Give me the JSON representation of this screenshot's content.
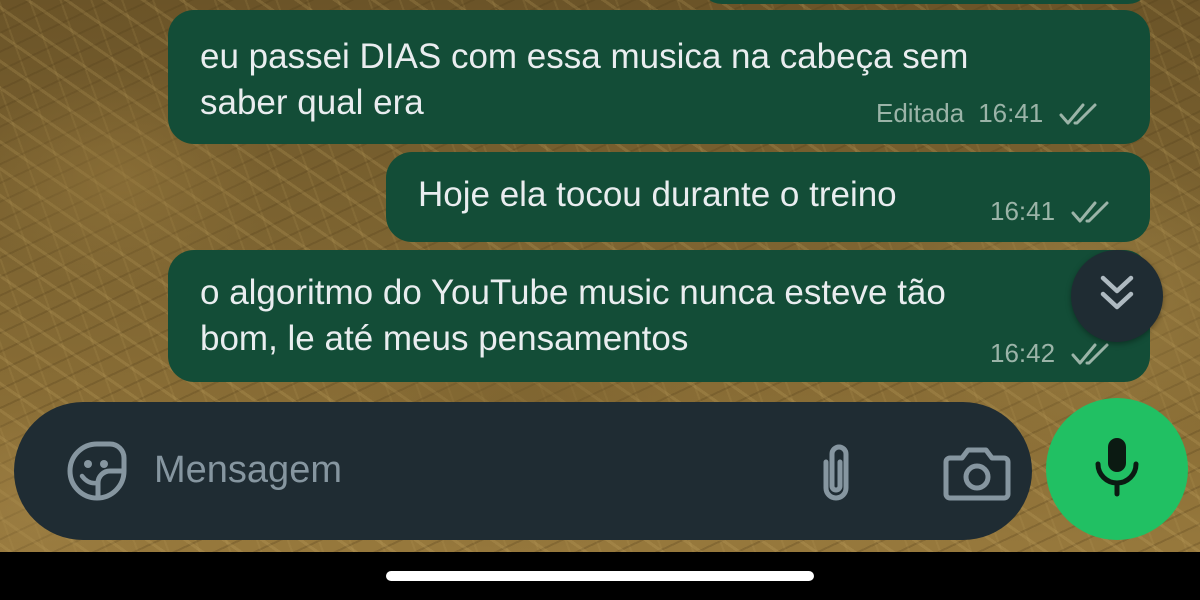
{
  "messages": [
    {
      "lines": [
        "eu passei DIAS com essa musica na cabeça sem",
        "saber qual era"
      ],
      "edited_label": "Editada",
      "time": "16:41",
      "status": "read"
    },
    {
      "lines": [
        "Hoje ela tocou durante o treino"
      ],
      "time": "16:41",
      "status": "read"
    },
    {
      "lines": [
        "o algoritmo do YouTube music nunca esteve tão",
        "bom, le até meus pensamentos"
      ],
      "time": "16:42",
      "status": "read"
    }
  ],
  "composer": {
    "placeholder": "Mensagem"
  },
  "icons": {
    "sticker": "sticker-icon",
    "attach": "paperclip-icon",
    "camera": "camera-icon",
    "mic": "microphone-icon",
    "scroll": "double-chevron-down-icon",
    "ticks": "double-check-icon"
  },
  "colors": {
    "bubble": "#134d37",
    "composer": "#1f2c33",
    "mic_button": "#21c063",
    "placeholder": "#8696a0"
  }
}
